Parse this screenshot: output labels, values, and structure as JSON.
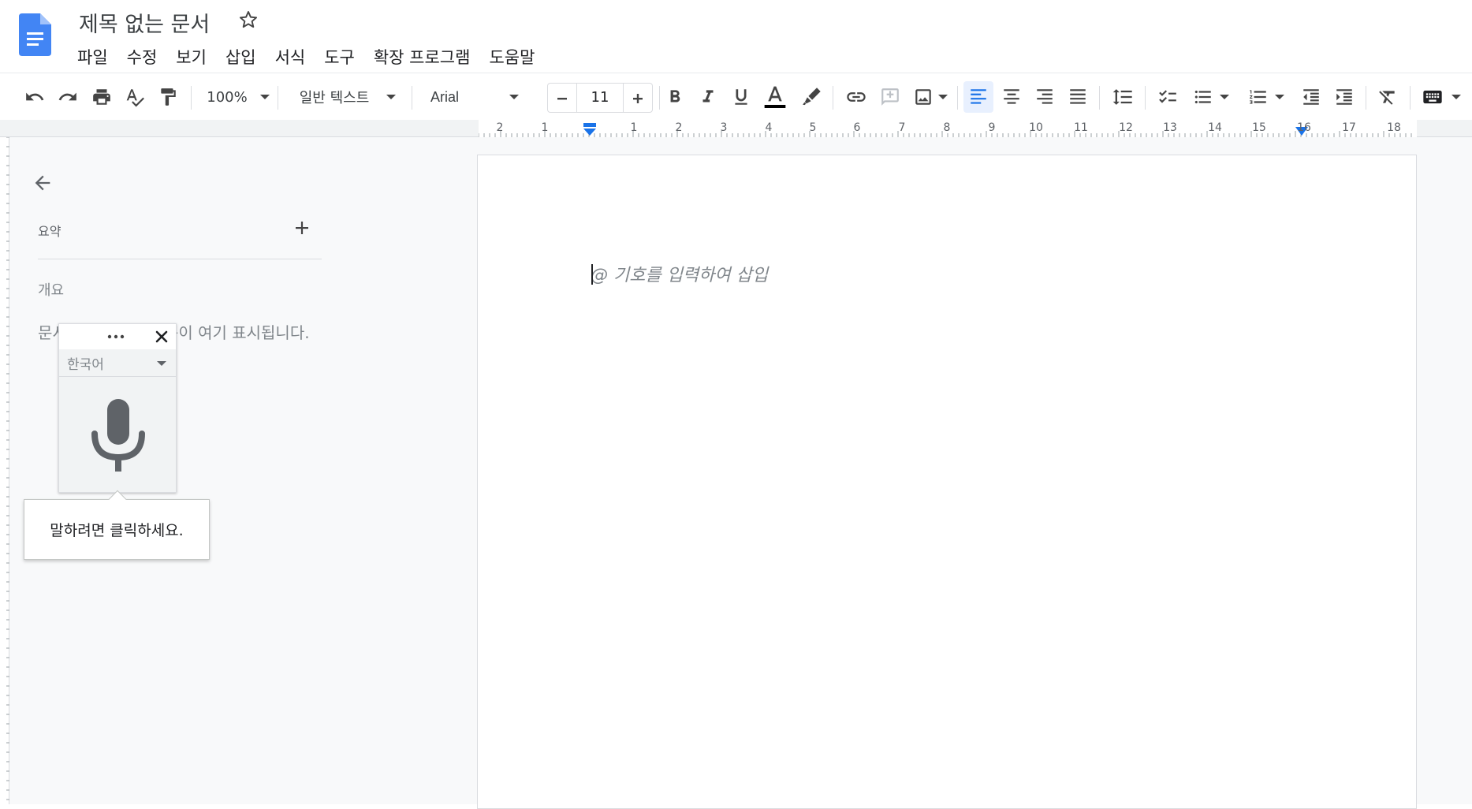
{
  "document": {
    "title": "제목 없는 문서",
    "placeholder": "@ 기호를 입력하여 삽입"
  },
  "menubar": {
    "items": [
      "파일",
      "수정",
      "보기",
      "삽입",
      "서식",
      "도구",
      "확장 프로그램",
      "도움말"
    ]
  },
  "toolbar": {
    "zoom": "100%",
    "style": "일반 텍스트",
    "font": "Arial",
    "font_size": "11"
  },
  "ruler": {
    "labels": [
      "2",
      "1",
      "1",
      "2",
      "3",
      "4",
      "5",
      "6",
      "7",
      "8",
      "9",
      "10",
      "11",
      "12",
      "13",
      "14",
      "15",
      "16",
      "17",
      "18"
    ]
  },
  "outline": {
    "label": "요약",
    "overview": "개요",
    "empty_text": "문서에 추가하는 제목이 여기 표시됩니다."
  },
  "voice_typing": {
    "language": "한국어",
    "tooltip": "말하려면 클릭하세요."
  },
  "colors": {
    "accent": "#1a73e8",
    "logo": "#4285f4",
    "canvas": "#f8f9fa"
  }
}
